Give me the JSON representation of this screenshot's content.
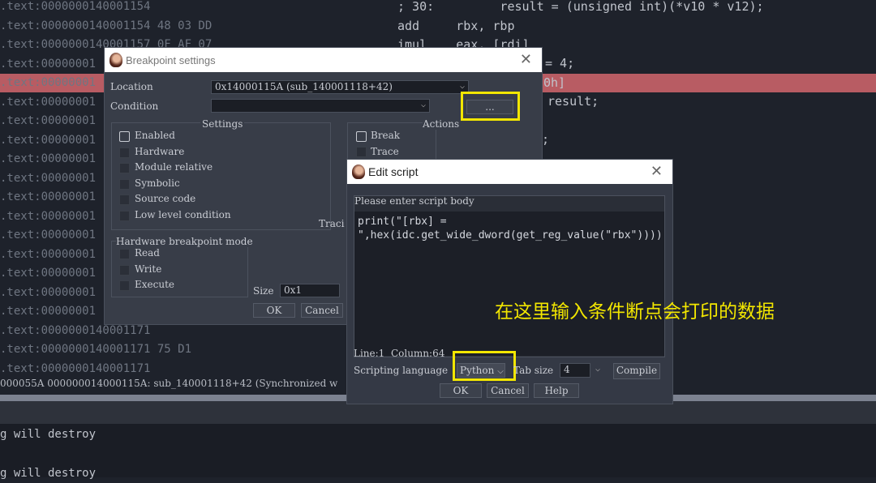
{
  "background": {
    "left_lines": [
      ".text:0000000140001154",
      ".text:0000000140001154 48 03 DD",
      ".text:0000000140001157 0F AF 07",
      ".text:00000001",
      ".text:00000001",
      ".text:00000001",
      ".text:00000001",
      ".text:00000001",
      ".text:00000001",
      ".text:00000001",
      ".text:00000001",
      ".text:00000001",
      ".text:00000001",
      ".text:00000001",
      ".text:00000001",
      ".text:00000001",
      ".text:00000001",
      ".text:0000000140001171",
      ".text:0000000140001171 75 D1",
      ".text:0000000140001171"
    ],
    "right_lines": [
      "; 30:         result = (unsigned int)(*v10 * v12);",
      "add     rbx, rbp",
      "imul    eax, [rdi]"
    ],
    "frag_row3": "= 4;",
    "frag_row4": "0h]",
    "frag_row5": "result;",
    "frag_row7": ";",
    "status": "000055A 000000014000115A: sub_140001118+42 (Synchronized w",
    "output_lines": [
      "g will destroy",
      "g will destroy"
    ],
    "highlight_color": "#b85c63"
  },
  "breakpoint": {
    "title": "Breakpoint settings",
    "location_label": "Location",
    "location_value": "0x14000115A (sub_140001118+42)",
    "condition_label": "Condition",
    "condition_value": "",
    "more_button": "...",
    "settings_title": "Settings",
    "settings": [
      {
        "label": "Enabled",
        "checked": false
      },
      {
        "label": "Hardware"
      },
      {
        "label": "Module relative"
      },
      {
        "label": "Symbolic"
      },
      {
        "label": "Source code"
      },
      {
        "label": "Low level condition"
      }
    ],
    "actions_title": "Actions",
    "actions": [
      "Break",
      "Trace"
    ],
    "tracing_label": "Traci",
    "hw_title": "Hardware breakpoint mode",
    "hw": [
      "Read",
      "Write",
      "Execute"
    ],
    "size_label": "Size",
    "size_value": "0x1",
    "ok": "OK",
    "cancel": "Cancel"
  },
  "edit": {
    "title": "Edit script",
    "prompt": "Please enter script body",
    "script": "print(\"[rbx] =\n\",hex(idc.get_wide_dword(get_reg_value(\"rbx\"))))",
    "status": "Line:1  Column:64",
    "lang_label": "Scripting language",
    "lang_value": "Python",
    "tab_label": "Tab size",
    "tab_value": "4",
    "compile": "Compile",
    "ok": "OK",
    "cancel": "Cancel",
    "help": "Help"
  },
  "annotation": {
    "text": "在这里输入条件断点会打印的数据",
    "color": "#f2e600"
  }
}
